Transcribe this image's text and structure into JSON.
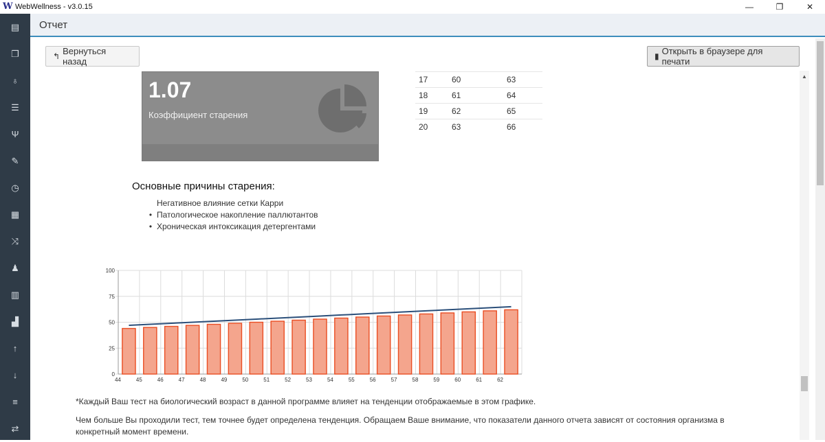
{
  "window": {
    "title": "WebWellness - v3.0.15",
    "logo_text": "W",
    "minimize": "—",
    "restore": "❐",
    "close": "✕"
  },
  "sidebar": {
    "items": [
      {
        "icon": "newspaper-icon",
        "glyph": "▤"
      },
      {
        "icon": "copy-icon",
        "glyph": "❐"
      },
      {
        "icon": "stethoscope-icon",
        "glyph": "♁"
      },
      {
        "icon": "sliders-icon",
        "glyph": "☰"
      },
      {
        "icon": "cutlery-icon",
        "glyph": "Ψ"
      },
      {
        "icon": "pencil-icon",
        "glyph": "✎"
      },
      {
        "icon": "clock-icon",
        "glyph": "◷"
      },
      {
        "icon": "calculator-icon",
        "glyph": "▦"
      },
      {
        "icon": "shuffle-icon",
        "glyph": "⤨"
      },
      {
        "icon": "person-icon",
        "glyph": "♟"
      },
      {
        "icon": "bar-chart-icon",
        "glyph": "▥"
      },
      {
        "icon": "signal-icon",
        "glyph": "▟"
      },
      {
        "icon": "arrow-up-icon",
        "glyph": "↑"
      },
      {
        "icon": "sort-icon",
        "glyph": "↓"
      },
      {
        "icon": "list-icon",
        "glyph": "≡"
      },
      {
        "icon": "exchange-icon",
        "glyph": "⇄"
      }
    ]
  },
  "header": {
    "title": "Отчет"
  },
  "toolbar": {
    "back_label": "Вернуться назад",
    "print_label": "Открыть в браузере для печати"
  },
  "stat": {
    "value": "1.07",
    "label": "Коэффициент старения",
    "icon": "pie-chart-icon"
  },
  "mini_table": {
    "rows": [
      [
        "17",
        "60",
        "63"
      ],
      [
        "18",
        "61",
        "64"
      ],
      [
        "19",
        "62",
        "65"
      ],
      [
        "20",
        "63",
        "66"
      ]
    ]
  },
  "reasons": {
    "title": "Основные причины старения:",
    "items": [
      {
        "text": "Негативное влияние сетки Карри",
        "bullet": ""
      },
      {
        "text": "Патологическое накопление паллютантов",
        "bullet": "•"
      },
      {
        "text": "Хроническая интоксикация детергентами",
        "bullet": "•"
      }
    ]
  },
  "chart_data": {
    "type": "bar",
    "categories": [
      "44",
      "45",
      "46",
      "47",
      "48",
      "49",
      "50",
      "51",
      "52",
      "53",
      "54",
      "55",
      "56",
      "57",
      "58",
      "59",
      "60",
      "61",
      "62"
    ],
    "series": [
      {
        "type": "bar",
        "values": [
          44,
          45,
          46,
          47,
          48,
          49,
          50,
          51,
          52,
          53,
          54,
          55,
          56,
          57,
          58,
          59,
          60,
          61,
          62
        ],
        "color": "#f4a58d",
        "stroke": "#ea4d22"
      },
      {
        "type": "line",
        "values": [
          47,
          48,
          49,
          50,
          51,
          52,
          53,
          54,
          55,
          56,
          57,
          58,
          59,
          60,
          61,
          62,
          63,
          64,
          65
        ],
        "color": "#2b4f7a"
      }
    ],
    "ylim": [
      0,
      100
    ],
    "yticks": [
      "0",
      "25",
      "50",
      "75",
      "100"
    ],
    "grid": true
  },
  "notes": {
    "note1": "*Каждый Ваш тест на биологический возраст в данной программе влияет на тенденции отображаемые в этом графике.",
    "note2": "Чем больше Вы проходили тест, тем точнее будет определена тенденция. Обращаем Ваше внимание, что показатели данного отчета зависят от состояния организма в конкретный момент времени."
  }
}
